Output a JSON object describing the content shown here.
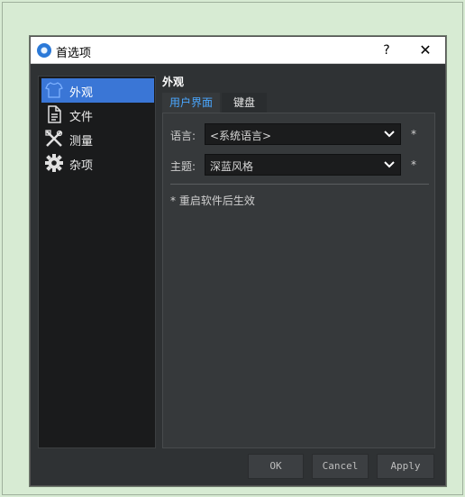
{
  "dialog": {
    "title": "首选项",
    "help_label": "?",
    "close_label": "✕"
  },
  "sidebar": {
    "items": [
      {
        "label": "外观",
        "icon": "shirt-icon",
        "selected": true
      },
      {
        "label": "文件",
        "icon": "file-icon",
        "selected": false
      },
      {
        "label": "测量",
        "icon": "tools-icon",
        "selected": false
      },
      {
        "label": "杂项",
        "icon": "gear-icon",
        "selected": false
      }
    ]
  },
  "section": {
    "title": "外观"
  },
  "tabs": [
    {
      "label": "用户界面",
      "active": true
    },
    {
      "label": "键盘",
      "active": false
    }
  ],
  "settings": {
    "language": {
      "label": "语言:",
      "value": "<系统语言>",
      "required_mark": "*"
    },
    "theme": {
      "label": "主题:",
      "value": "深蓝风格",
      "required_mark": "*"
    },
    "note": "* 重启软件后生效"
  },
  "buttons": {
    "ok": "OK",
    "cancel": "Cancel",
    "apply": "Apply"
  },
  "colors": {
    "accent": "#3a76d6",
    "tab_active_text": "#4aa7ff",
    "background_outer": "#d7ebd3",
    "dialog_bg": "#2f3234"
  }
}
